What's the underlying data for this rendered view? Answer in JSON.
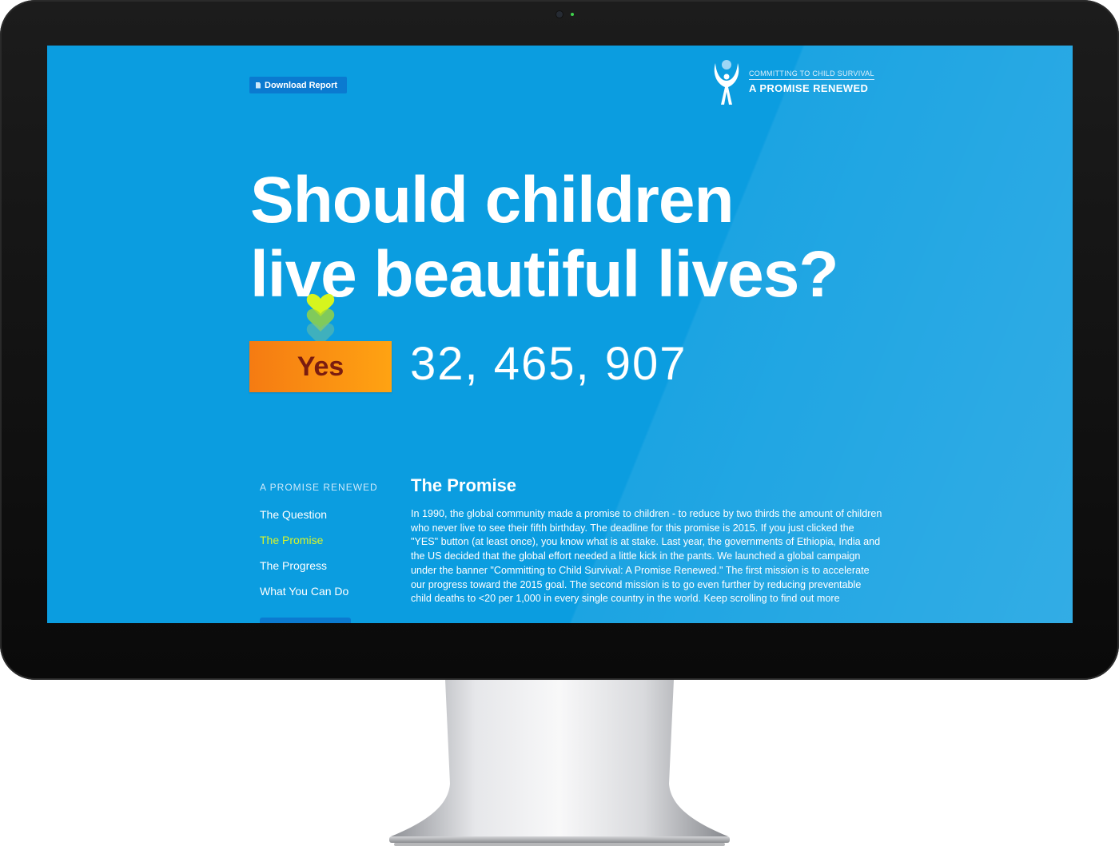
{
  "page": {
    "download_label": "Download Report",
    "brand": {
      "top": "COMMITTING TO CHILD SURVIVAL",
      "bottom": "A PROMISE RENEWED"
    },
    "headline": {
      "line1": "Should children",
      "line2": "live beautiful lives?"
    },
    "yes_label": "Yes",
    "counter": "32, 465, 907",
    "nav": {
      "title": "A PROMISE RENEWED",
      "items": [
        {
          "label": "The Question"
        },
        {
          "label": "The Promise",
          "active": true
        },
        {
          "label": "The Progress"
        },
        {
          "label": "What You Can Do"
        }
      ]
    },
    "section": {
      "title": "The Promise",
      "body": "In 1990, the global community made a promise to children - to reduce by two thirds the amount of children who never live to see their fifth birthday. The deadline for this promise is 2015. If you just clicked the \"YES\" button (at least once), you know what is at stake. Last year, the governments of Ethiopia, India and the US decided that the global effort needed a little kick in the pants. We launched a global campaign under the banner \"Committing to Child Survival: A Promise Renewed.\" The first mission is to accelerate our progress toward the 2015 goal.  The second mission is to go even further by reducing preventable child deaths to <20 per 1,000 in every single country in the world. Keep scrolling to find out more"
    },
    "colors": {
      "screen_bg": "#0b9de0",
      "yes_button": "#f88a12",
      "active_nav": "#d9f52a",
      "download_button": "#0b7ad0"
    },
    "icons": [
      "document-icon",
      "promise-logo-icon",
      "heart-icon"
    ]
  }
}
